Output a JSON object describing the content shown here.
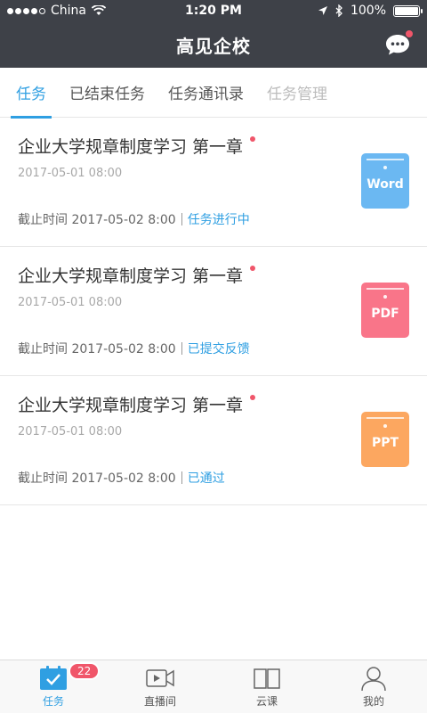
{
  "status_bar": {
    "carrier": "China",
    "time": "1:20 PM",
    "battery": "100%",
    "battery_level": 1.0
  },
  "header": {
    "title": "高见企校"
  },
  "tabs": [
    {
      "label": "任务",
      "active": true
    },
    {
      "label": "已结束任务",
      "active": false
    },
    {
      "label": "任务通讯录",
      "active": false
    },
    {
      "label": "任务管理",
      "disabled": true
    }
  ],
  "tasks": [
    {
      "title": "企业大学规章制度学习 第一章",
      "date": "2017-05-01 08:00",
      "deadline": "截止时间 2017-05-02 8:00",
      "status": "任务进行中",
      "file_type": "Word",
      "file_color": "#6bb8f2"
    },
    {
      "title": "企业大学规章制度学习 第一章",
      "date": "2017-05-01 08:00",
      "deadline": "截止时间 2017-05-02 8:00",
      "status": "已提交反馈",
      "file_type": "PDF",
      "file_color": "#f97589"
    },
    {
      "title": "企业大学规章制度学习 第一章",
      "date": "2017-05-01 08:00",
      "deadline": "截止时间 2017-05-02 8:00",
      "status": "已通过",
      "file_type": "PPT",
      "file_color": "#fca760"
    }
  ],
  "tabbar": {
    "items": [
      {
        "label": "任务",
        "icon": "task-check-icon",
        "badge": "22"
      },
      {
        "label": "直播间",
        "icon": "video-camera-icon"
      },
      {
        "label": "云课",
        "icon": "book-icon"
      },
      {
        "label": "我的",
        "icon": "user-icon"
      }
    ]
  },
  "colors": {
    "accent": "#2f9fe2",
    "header_bg": "#3e4148",
    "badge": "#f0566a"
  }
}
